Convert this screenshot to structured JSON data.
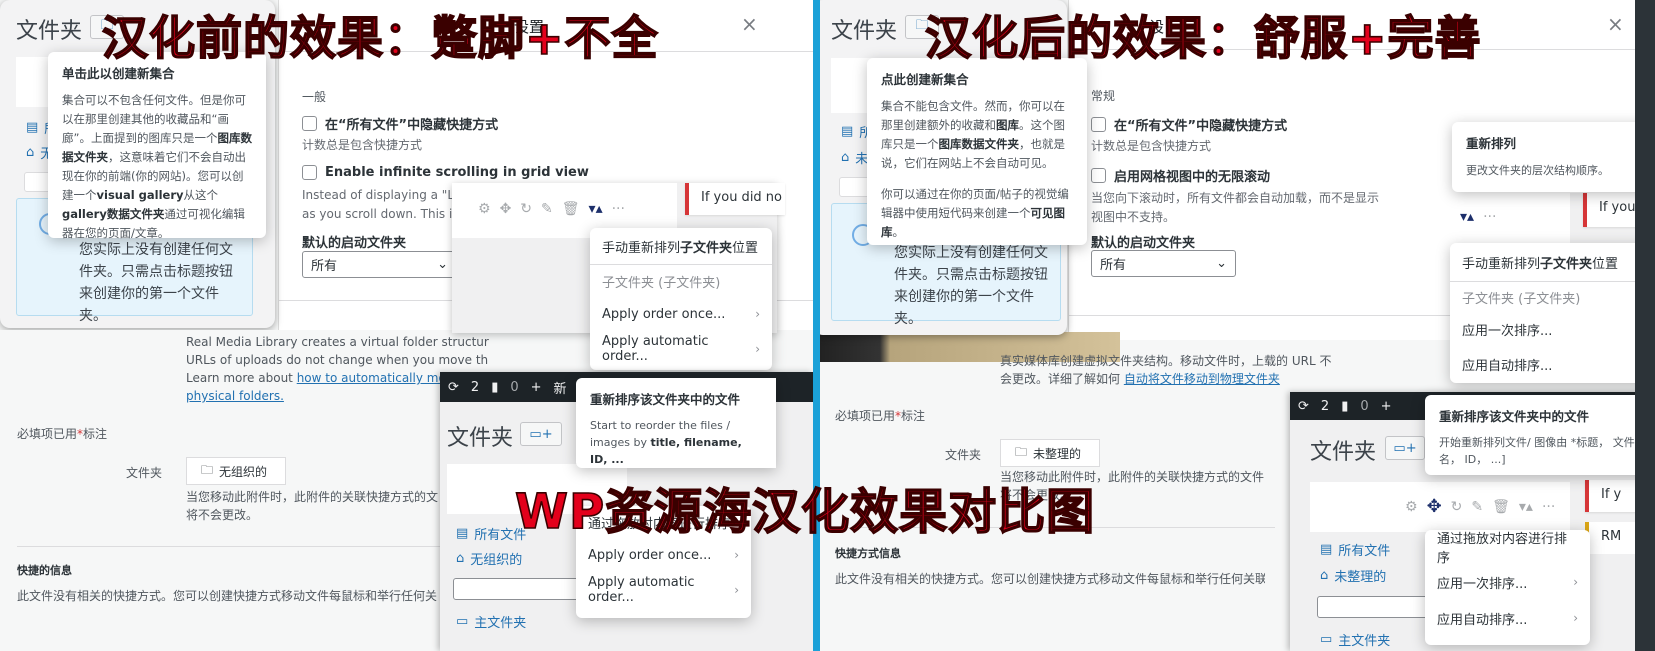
{
  "captions": {
    "left_title": "汉化前的效果：蹩脚+不全",
    "right_title": "汉化后的效果：舒服+完善",
    "center_title": "WP资源海汉化效果对比图"
  },
  "colors": {
    "caption_red": "#e3001b",
    "divider_blue": "#1ba1d8",
    "wp_link": "#2271b1",
    "active_icon": "#1d2f6b",
    "notice_red": "#d63638",
    "notice_yellow": "#dba617"
  },
  "before": {
    "folders_panel": {
      "title": "文件夹",
      "tree": [
        {
          "icon": "document-icon",
          "label": "所有文件"
        },
        {
          "icon": "home-icon",
          "label": "无组织的"
        }
      ],
      "empty_info": "您实际上没有创建任何文件夹。只需点击标题按钮来创建你的第一个文件夹。"
    },
    "collection_tooltip": {
      "title": "单击此以创建新集合",
      "body_html_parts": [
        {
          "text": "集合可以不包含任何文件。但是你可以在那里创建其他的收藏品和“画廊”。上面提到的图库只是一个",
          "bold": false
        },
        {
          "text": "图库数据文件夹",
          "bold": true
        },
        {
          "text": "，这意味着它们不会自动出现在你的前端(你的网站)。您可以创建一个",
          "bold": false
        },
        {
          "text": "visual gallery",
          "bold": true
        },
        {
          "text": "从这个",
          "bold": false
        },
        {
          "text": "gallery数据文件夹",
          "bold": true
        },
        {
          "text": "通过可视化编辑器在您的页面/文章。",
          "bold": false
        }
      ]
    },
    "settings": {
      "header_partial": "设置",
      "section": "一般",
      "option1_label": "在“所有文件”中隐藏快捷方式",
      "option1_desc": "计数总是包含快捷方式",
      "option2_label": "Enable infinite scrolling in grid view",
      "option2_desc_line1": "Instead of displaying a \"Lo",
      "option2_desc_line2": "as you scroll down. This is",
      "default_folder_label": "默认的启动文件夹",
      "default_folder_value": "所有"
    },
    "notice_partial": "If you did no",
    "subfolder_menu": {
      "header_plain": "手动重新排列",
      "header_bold": "子文件夹",
      "header_tail": "位置",
      "group_label": "子文件夹 (子文件夹)",
      "items": [
        "Apply order once...",
        "Apply automatic order..."
      ]
    },
    "attachment": {
      "rml_description_line1": "Real Media Library creates a virtual folder structur",
      "rml_description_line2": "URLs of uploads do not change when you move th",
      "rml_description_line3_prefix": "Learn more about ",
      "rml_link_line1": "how to automatically move files",
      "rml_link_line2": "physical folders.",
      "required_note_prefix": "必填项已用",
      "required_star": "*",
      "required_note_suffix": "标注",
      "folder_label": "文件夹",
      "folder_value": "无组织的",
      "folder_desc_line1": "当您移动此附件时，此附件的关联快捷方式的文",
      "folder_desc_line2": "将不会更改。",
      "shortcut_title": "快捷的信息",
      "shortcut_desc": "此文件没有相关的快捷方式。您可以创建快捷方式移动文件每鼠标和举行任何关"
    },
    "mini_window": {
      "adminbar": {
        "updates": "2",
        "comments": "0",
        "new_partial": "新"
      },
      "title": "文件夹",
      "tree": [
        {
          "icon": "document-icon",
          "label": "所有文件"
        },
        {
          "icon": "home-icon",
          "label": "无组织的"
        }
      ],
      "partial_label": "夹",
      "partial_folder": "主文件夹"
    },
    "reorder_tooltip": {
      "title": "重新排序该文件夹中的文件",
      "body_prefix": "Start to reorder the files / images by ",
      "body_bold": "title, filename, ID, ...",
      "body_suffix": ""
    },
    "content_menu": {
      "items": [
        {
          "label": "通过拖放对内容进行排序",
          "chevron": false
        },
        {
          "label": "Apply order once...",
          "chevron": true
        },
        {
          "label": "Apply automatic order...",
          "chevron": true
        }
      ]
    }
  },
  "after": {
    "folders_panel": {
      "title": "文件夹",
      "tree": [
        {
          "icon": "document-icon",
          "label": "所有文件"
        },
        {
          "icon": "home-icon",
          "label": "未整理的"
        }
      ],
      "empty_info": "您实际上没有创建任何文件夹。只需点击标题按钮来创建你的第一个文件夹。"
    },
    "collection_tooltip": {
      "title": "点此创建新集合",
      "body_html_parts": [
        {
          "text": "集合不能包含文件。然而，你可以在那里创建额外的收藏和",
          "bold": false
        },
        {
          "text": "图库",
          "bold": true
        },
        {
          "text": "。这个图库只是一个",
          "bold": false
        },
        {
          "text": "图库数据文件夹",
          "bold": true
        },
        {
          "text": "，也就是说，它们在网站上不会自动可见。",
          "bold": false
        }
      ],
      "body2_parts": [
        {
          "text": "你可以通过在你的页面/帖子的视觉编辑器中使用短代码来创建一个",
          "bold": false
        },
        {
          "text": "可见图库",
          "bold": true
        },
        {
          "text": "。",
          "bold": false
        }
      ]
    },
    "settings": {
      "header_partial": "设",
      "section": "常规",
      "option1_label": "在“所有文件”中隐藏快捷方式",
      "option1_desc": "计数总是包含快捷方式",
      "option2_label": "启用网格视图中的无限滚动",
      "option2_desc_line1": "当您向下滚动时，所有文件都会自动加载，而不是显示",
      "option2_desc_line2": "视图中不支持。",
      "default_folder_label": "默认的启动文件夹",
      "default_folder_value": "所有"
    },
    "rearrange_tooltip": {
      "title": "重新排列",
      "body": "更改文件夹的层次结构顺序。"
    },
    "notice_partial": "If you did no",
    "subfolder_menu": {
      "header_plain": "手动重新排列",
      "header_bold": "子文件夹",
      "header_tail": "位置",
      "group_label": "子文件夹 (子文件夹)",
      "items": [
        "应用一次排序...",
        "应用自动排序..."
      ]
    },
    "attachment": {
      "rml_description_line1": "真实媒体库创建虚拟文件夹结构。移动文件时，上载的 URL 不",
      "rml_description_line2_prefix": "会更改。详细了解如何 ",
      "rml_link": "自动将文件移动到物理文件夹",
      "required_note_prefix": "必填项已用",
      "required_star": "*",
      "required_note_suffix": "标注",
      "folder_label": "文件夹",
      "folder_value": "未整理的",
      "folder_desc_line1": "当您移动此附件时，此附件的关联快捷方式的文件",
      "folder_desc_line2": "将不会更改。",
      "shortcut_title": "快捷方式信息",
      "shortcut_desc": "此文件没有相关的快捷方式。您可以创建快捷方式移动文件每鼠标和举行任何关联"
    },
    "mini_window": {
      "adminbar": {
        "updates": "2",
        "comments": "0"
      },
      "title": "文件夹",
      "tree": [
        {
          "icon": "document-icon",
          "label": "所有文件"
        },
        {
          "icon": "home-icon",
          "label": "未整理的"
        }
      ],
      "partial_folder": "主文件夹"
    },
    "reorder_tooltip": {
      "title": "重新排序该文件夹中的文件",
      "body": "开始重新排列文件/ 图像由 *标题， 文件名， ID， ...]"
    },
    "content_menu": {
      "items": [
        {
          "label": "通过拖放对内容进行排序",
          "chevron": false
        },
        {
          "label": "应用一次排序...",
          "chevron": true
        },
        {
          "label": "应用自动排序...",
          "chevron": true
        }
      ]
    },
    "side_notices": {
      "partial1": "If y",
      "partial2": "RM"
    }
  },
  "icons": {
    "close": "×",
    "chevron_right": "›",
    "chevron_down": "⌄",
    "gear": "⚙",
    "move": "✥",
    "refresh": "↻",
    "pencil": "✎",
    "trash": "🗑",
    "sort": "▾▴",
    "more": "···",
    "folder": "🗀",
    "update": "⟳",
    "comment": "💬",
    "plus": "+"
  }
}
